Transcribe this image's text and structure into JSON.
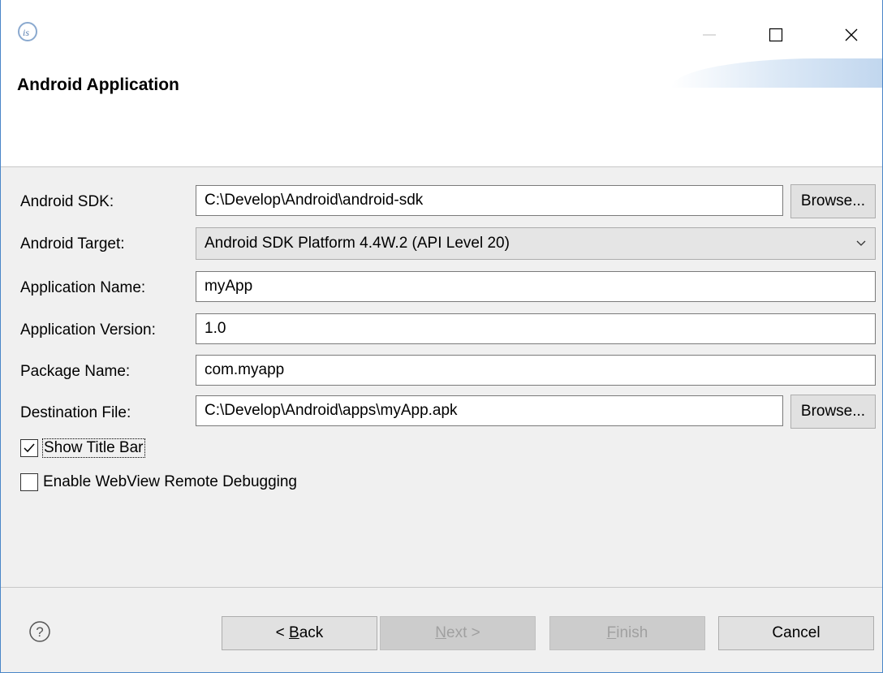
{
  "window": {
    "title": "Android Application",
    "app_icon": "is-logo-icon",
    "controls": [
      "minimize-icon",
      "maximize-icon",
      "close-icon"
    ]
  },
  "form": {
    "android_sdk": {
      "label": "Android SDK:",
      "value": "C:\\Develop\\Android\\android-sdk",
      "browse": "Browse..."
    },
    "android_target": {
      "label": "Android Target:",
      "value": "Android SDK Platform 4.4W.2 (API Level 20)"
    },
    "application_name": {
      "label": "Application Name:",
      "value": "myApp"
    },
    "application_version": {
      "label": "Application Version:",
      "value": "1.0"
    },
    "package_name": {
      "label": "Package Name:",
      "value": "com.myapp"
    },
    "destination_file": {
      "label": "Destination File:",
      "value": "C:\\Develop\\Android\\apps\\myApp.apk",
      "browse": "Browse..."
    },
    "show_title_bar": {
      "label": "Show Title Bar",
      "checked": true
    },
    "webview_debugging": {
      "label": "Enable WebView Remote Debugging",
      "checked": false
    }
  },
  "footer": {
    "help_icon": "question-circle-icon",
    "back": {
      "prefix": "< ",
      "mnemonic": "B",
      "rest": "ack"
    },
    "next": {
      "mnemonic": "N",
      "rest": "ext >"
    },
    "finish": {
      "mnemonic": "F",
      "rest": "inish"
    },
    "cancel": "Cancel"
  },
  "colors": {
    "window_border": "#4a86c8",
    "panel": "#f0f0f0",
    "disabled_text": "#a0a0a0"
  }
}
